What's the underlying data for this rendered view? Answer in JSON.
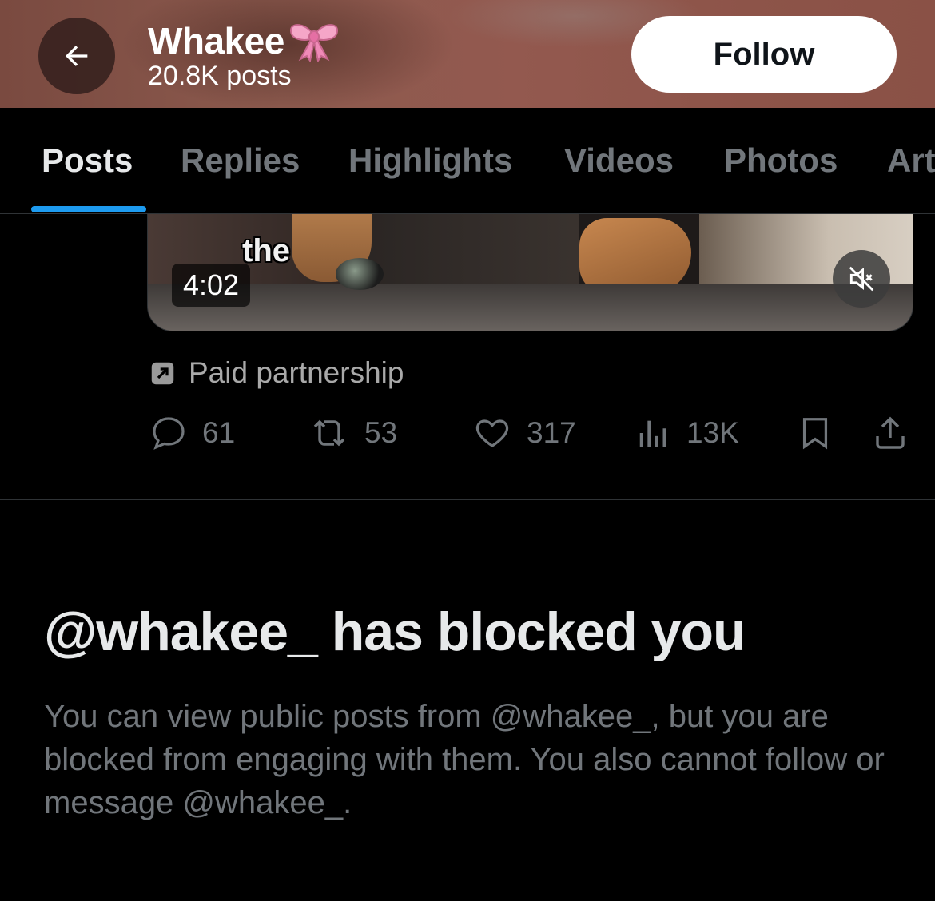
{
  "header": {
    "name": "Whakee",
    "name_emoji_icon": "ribbon-bow-icon",
    "post_count": "20.8K posts",
    "follow_label": "Follow",
    "background_color": "#8c5a4e"
  },
  "tabs": [
    {
      "label": "Posts",
      "active": true
    },
    {
      "label": "Replies",
      "active": false
    },
    {
      "label": "Highlights",
      "active": false
    },
    {
      "label": "Videos",
      "active": false
    },
    {
      "label": "Photos",
      "active": false
    },
    {
      "label": "Articles",
      "active": false
    }
  ],
  "media": {
    "caption_word": "the",
    "duration": "4:02",
    "mute_icon": "speaker-muted-icon"
  },
  "post": {
    "paid_label": "Paid partnership",
    "actions": {
      "replies": "61",
      "reposts": "53",
      "likes": "317",
      "views": "13K"
    }
  },
  "blocked": {
    "title": "@whakee_ has blocked you",
    "description": "You can view public posts from @whakee_, but you are blocked from engaging with them. You also cannot follow or message @whakee_."
  },
  "colors": {
    "accent": "#1d9bf0",
    "muted_text": "#71767b",
    "primary_text": "#e7e9ea",
    "background": "#000000"
  }
}
